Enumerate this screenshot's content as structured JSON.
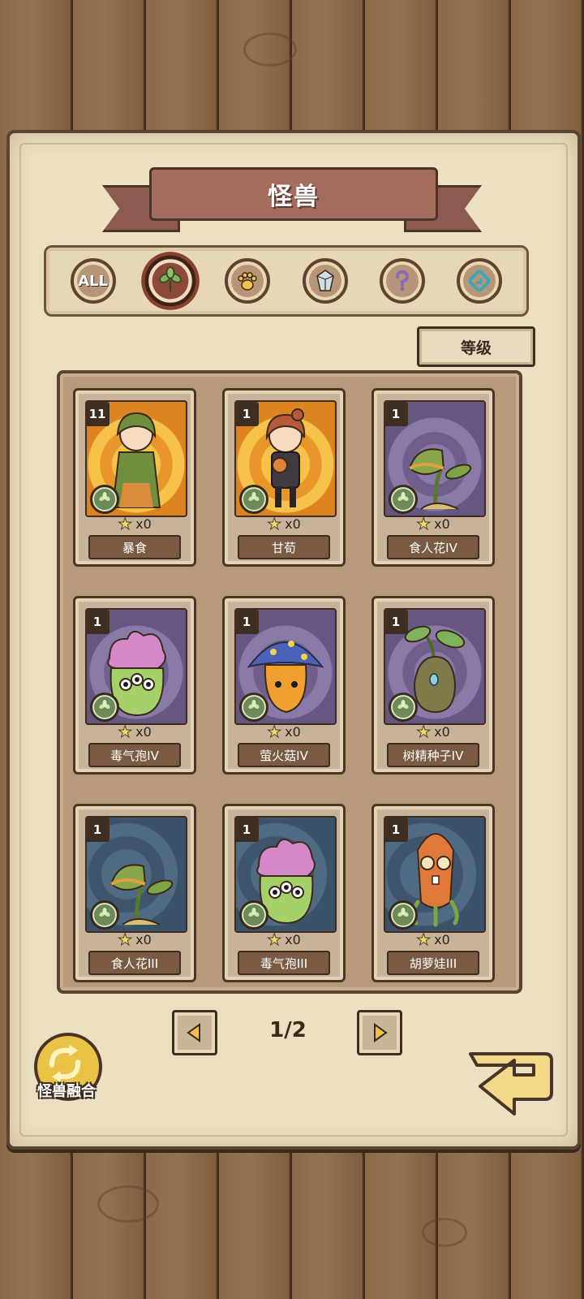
{
  "header": {
    "title": "怪兽"
  },
  "filters": [
    {
      "id": "all",
      "label": "ALL",
      "icon": "all-text-icon",
      "active": false
    },
    {
      "id": "plant",
      "label": "",
      "icon": "leaf-icon",
      "active": true
    },
    {
      "id": "beast",
      "label": "",
      "icon": "paw-icon",
      "active": false
    },
    {
      "id": "crystal",
      "label": "",
      "icon": "crystal-icon",
      "active": false
    },
    {
      "id": "unknown",
      "label": "",
      "icon": "question-icon",
      "active": false
    },
    {
      "id": "mech",
      "label": "",
      "icon": "gear-icon",
      "active": false
    }
  ],
  "sort": {
    "label": "等级"
  },
  "cards": [
    {
      "level": "11",
      "name": "暴食",
      "stars": "x0",
      "bg": "gold",
      "creature": "green-girl-icon"
    },
    {
      "level": "1",
      "name": "甘荀",
      "stars": "x0",
      "bg": "gold",
      "creature": "red-hair-girl-icon"
    },
    {
      "level": "1",
      "name": "食人花IV",
      "stars": "x0",
      "bg": "purple",
      "creature": "flytrap-icon"
    },
    {
      "level": "1",
      "name": "毒气孢IV",
      "stars": "x0",
      "bg": "purple",
      "creature": "spore-blob-icon"
    },
    {
      "level": "1",
      "name": "萤火菇IV",
      "stars": "x0",
      "bg": "purple",
      "creature": "glow-mushroom-icon"
    },
    {
      "level": "1",
      "name": "树精种子IV",
      "stars": "x0",
      "bg": "purple",
      "creature": "sprout-seed-icon"
    },
    {
      "level": "1",
      "name": "食人花III",
      "stars": "x0",
      "bg": "slate",
      "creature": "flytrap-icon"
    },
    {
      "level": "1",
      "name": "毒气孢III",
      "stars": "x0",
      "bg": "slate",
      "creature": "spore-blob-icon"
    },
    {
      "level": "1",
      "name": "胡萝娃III",
      "stars": "x0",
      "bg": "slate",
      "creature": "carrot-icon"
    }
  ],
  "pager": {
    "page": "1/2"
  },
  "fusion": {
    "label": "怪兽融合"
  },
  "colors": {
    "paper": "#ece0c2",
    "ribbon": "#a46b5e",
    "board": "#b79a7c",
    "plank": "#8a6a4a"
  }
}
